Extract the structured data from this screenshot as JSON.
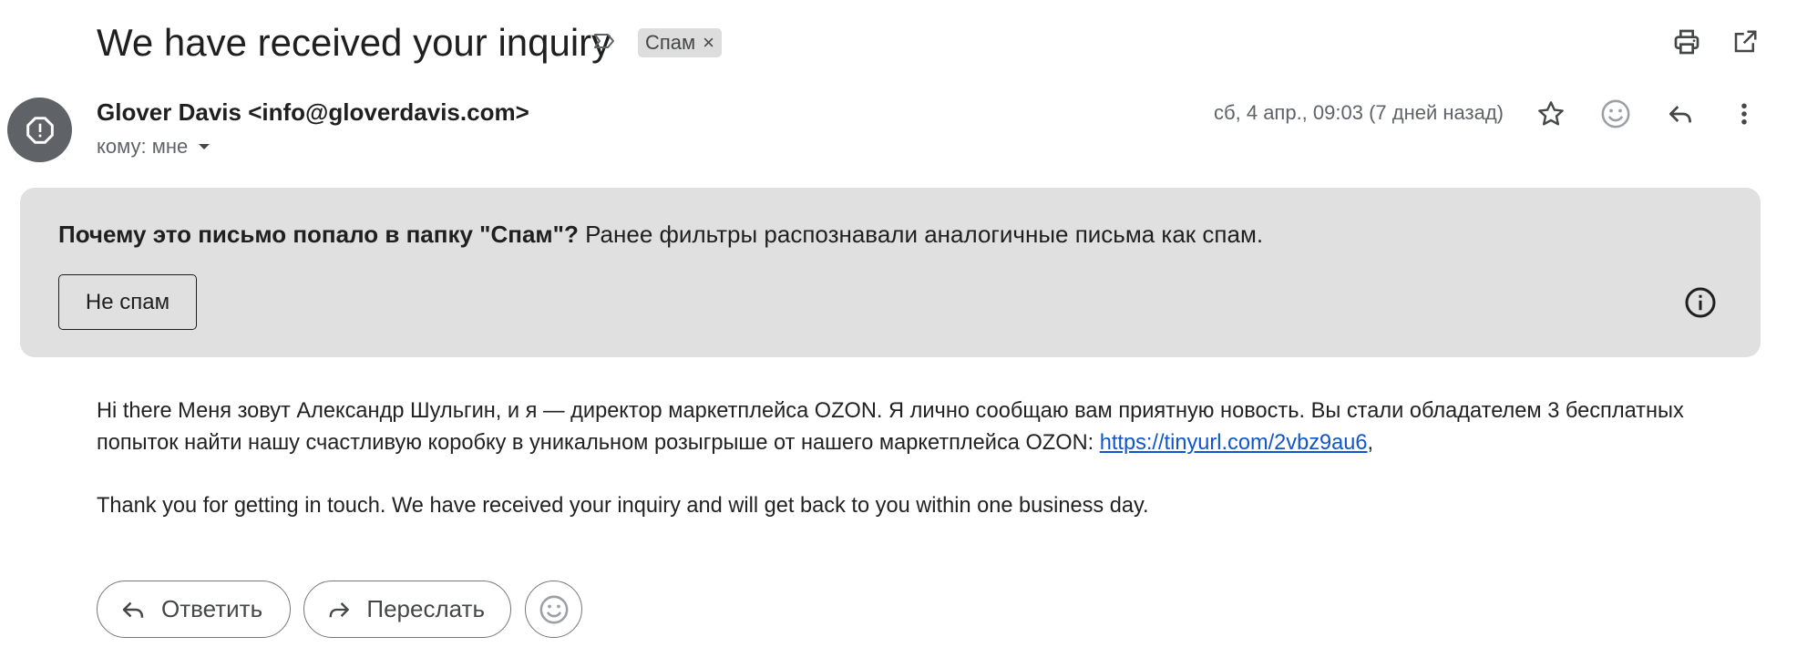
{
  "email": {
    "subject": "We have received your inquiry",
    "label_chip": "Спам",
    "label_chip_close": "×",
    "sender": "Glover Davis <info@gloverdavis.com>",
    "recipient_label": "кому: мне",
    "date": "сб, 4 апр., 09:03 (7 дней назад)"
  },
  "spam_banner": {
    "question": "Почему это письмо попало в папку \"Спам\"?",
    "explanation": " Ранее фильтры распознавали аналогичные письма как спам.",
    "not_spam_label": "Не спам"
  },
  "body": {
    "paragraph1_text": "Hi there Меня зовут Александр Шульгин, и я — директор маркетплейса OZON. Я лично сообщаю вам приятную новость. Вы стали обладателем 3 бесплатных попыток найти нашу счастливую коробку в уникальном розыгрыше от нашего маркетплейса OZON: ",
    "paragraph1_link": "https://tinyurl.com/2vbz9au6",
    "paragraph1_tail": ",",
    "paragraph2_text": "Thank you for getting in touch. We have received your inquiry and will get back to you within one business day."
  },
  "actions": {
    "reply_label": "Ответить",
    "forward_label": "Переслать"
  },
  "icons": {
    "important": "important-marker-icon",
    "print": "print-icon",
    "open_new_window": "open-in-new-icon",
    "avatar": "warning-icon",
    "star": "star-icon",
    "emoji": "emoji-icon",
    "reply": "reply-icon",
    "more": "more-vert-icon",
    "info": "info-icon",
    "dropdown": "chevron-down-icon",
    "forward": "forward-icon"
  },
  "colors": {
    "banner_bg": "#e0e0e0",
    "avatar_bg": "#5f6368",
    "link": "#1155cc",
    "chip_bg": "#dddddd"
  }
}
